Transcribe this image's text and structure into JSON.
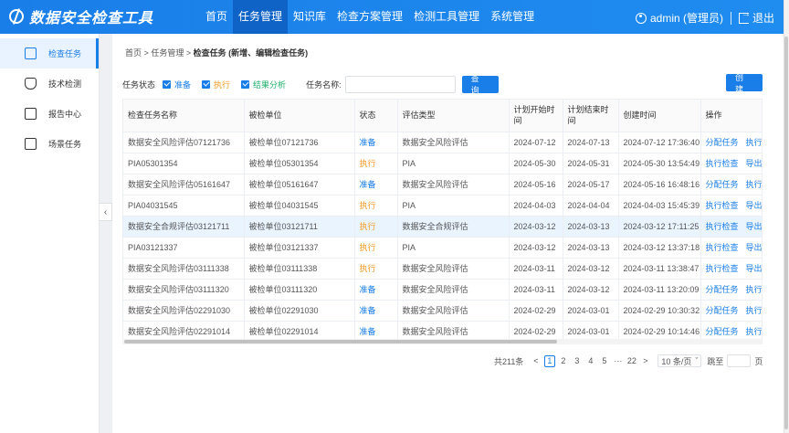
{
  "app": {
    "title": "数据安全检查工具"
  },
  "nav": {
    "items": [
      "首页",
      "任务管理",
      "知识库",
      "检查方案管理",
      "检测工具管理",
      "系统管理"
    ],
    "active": 1
  },
  "user": {
    "name": "admin (管理员)",
    "logout": "退出"
  },
  "sidebar": {
    "items": [
      {
        "label": "检查任务",
        "icon": "task-list-icon"
      },
      {
        "label": "技术检测",
        "icon": "shield-check-icon"
      },
      {
        "label": "报告中心",
        "icon": "report-icon"
      },
      {
        "label": "场景任务",
        "icon": "scene-icon"
      }
    ]
  },
  "breadcrumb": {
    "home": "首页",
    "sep": ">",
    "parent": "任务管理",
    "current": "检查任务 (新增、编辑检查任务)"
  },
  "filter": {
    "status_label": "任务状态",
    "options": [
      "准备",
      "执行",
      "结果分析"
    ],
    "name_label": "任务名称:",
    "name_value": "",
    "search_button": "查 询",
    "create_button": "创 建"
  },
  "table": {
    "columns": [
      "检查任务名称",
      "被检单位",
      "状态",
      "评估类型",
      "计划开始时间",
      "计划结束时间",
      "创建时间",
      "操作"
    ],
    "rows": [
      {
        "name": "数据安全风险评估07121736",
        "unit": "被检单位07121736",
        "status": "准备",
        "type": "数据安全风险评估",
        "start": "2024-07-12",
        "end": "2024-07-13",
        "created": "2024-07-12 17:36:40",
        "op1": "分配任务",
        "op2": "执行"
      },
      {
        "name": "PIA05301354",
        "unit": "被检单位05301354",
        "status": "执行",
        "type": "PIA",
        "start": "2024-05-30",
        "end": "2024-05-31",
        "created": "2024-05-30 13:54:49",
        "op1": "执行检查",
        "op2": "导出"
      },
      {
        "name": "数据安全风险评估05161647",
        "unit": "被检单位05161647",
        "status": "准备",
        "type": "数据安全风险评估",
        "start": "2024-05-16",
        "end": "2024-05-17",
        "created": "2024-05-16 16:48:16",
        "op1": "分配任务",
        "op2": "执行"
      },
      {
        "name": "PIA04031545",
        "unit": "被检单位04031545",
        "status": "执行",
        "type": "PIA",
        "start": "2024-04-03",
        "end": "2024-04-04",
        "created": "2024-04-03 15:45:39",
        "op1": "执行检查",
        "op2": "导出"
      },
      {
        "name": "数据安全合规评估03121711",
        "unit": "被检单位03121711",
        "status": "执行",
        "type": "数据安全合规评估",
        "start": "2024-03-12",
        "end": "2024-03-13",
        "created": "2024-03-12 17:11:25",
        "op1": "执行检查",
        "op2": "导出"
      },
      {
        "name": "PIA03121337",
        "unit": "被检单位03121337",
        "status": "执行",
        "type": "PIA",
        "start": "2024-03-12",
        "end": "2024-03-13",
        "created": "2024-03-12 13:37:18",
        "op1": "执行检查",
        "op2": "导出"
      },
      {
        "name": "数据安全风险评估03111338",
        "unit": "被检单位03111338",
        "status": "执行",
        "type": "数据安全风险评估",
        "start": "2024-03-11",
        "end": "2024-03-12",
        "created": "2024-03-11 13:38:47",
        "op1": "执行检查",
        "op2": "导出"
      },
      {
        "name": "数据安全风险评估03111320",
        "unit": "被检单位03111320",
        "status": "准备",
        "type": "数据安全风险评估",
        "start": "2024-03-11",
        "end": "2024-03-12",
        "created": "2024-03-11 13:20:09",
        "op1": "分配任务",
        "op2": "执行"
      },
      {
        "name": "数据安全风险评估02291030",
        "unit": "被检单位02291030",
        "status": "准备",
        "type": "数据安全风险评估",
        "start": "2024-02-29",
        "end": "2024-03-01",
        "created": "2024-02-29 10:30:32",
        "op1": "分配任务",
        "op2": "执行"
      },
      {
        "name": "数据安全风险评估02291014",
        "unit": "被检单位02291014",
        "status": "准备",
        "type": "数据安全风险评估",
        "start": "2024-02-29",
        "end": "2024-03-01",
        "created": "2024-02-29 10:14:46",
        "op1": "分配任务",
        "op2": "执行"
      }
    ],
    "highlighted_row": 4
  },
  "pagination": {
    "total": "共211条",
    "prev": "<",
    "pages": [
      "1",
      "2",
      "3",
      "4",
      "5",
      "···",
      "22"
    ],
    "current": "1",
    "next": ">",
    "page_size": "10 条/页",
    "goto_label": "跳至",
    "page_unit": "页"
  },
  "colors": {
    "primary": "#1a7ee8",
    "prepare": "#1a7ee8",
    "execute": "#f59a23",
    "highlight_row": "#eaf4ff"
  }
}
